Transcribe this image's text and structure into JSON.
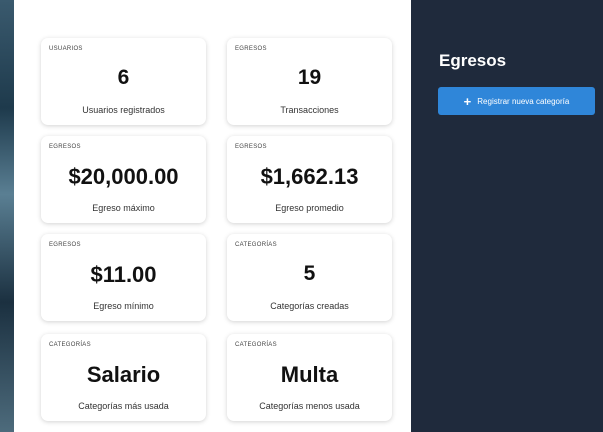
{
  "cards": [
    {
      "category": "USUARIOS",
      "value": "6",
      "label": "Usuarios registrados"
    },
    {
      "category": "EGRESOS",
      "value": "19",
      "label": "Transacciones"
    },
    {
      "category": "EGRESOS",
      "value": "$20,000.00",
      "label": "Egreso máximo"
    },
    {
      "category": "EGRESOS",
      "value": "$1,662.13",
      "label": "Egreso promedio"
    },
    {
      "category": "EGRESOS",
      "value": "$11.00",
      "label": "Egreso mínimo"
    },
    {
      "category": "CATEGORÍAS",
      "value": "5",
      "label": "Categorías creadas"
    },
    {
      "category": "CATEGORÍAS",
      "value": "Salario",
      "label": "Categorías más usada"
    },
    {
      "category": "CATEGORÍAS",
      "value": "Multa",
      "label": "Categorías menos usada"
    }
  ],
  "side": {
    "title": "Egresos",
    "button_label": "Registrar nueva categoría",
    "button_icon": "plus-icon"
  },
  "colors": {
    "sidebar_bg": "#1f2a3c",
    "button_bg": "#2f86d9",
    "card_bg": "#ffffff"
  }
}
